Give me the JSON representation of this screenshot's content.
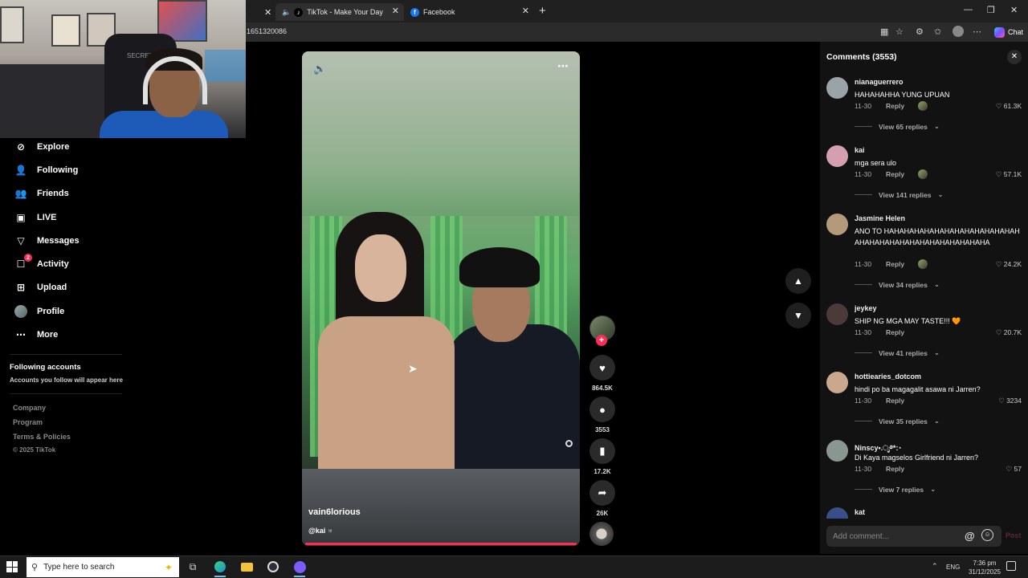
{
  "browser": {
    "tabs": [
      {
        "label": "TikTok - Make Your Day",
        "favicon": "tiktok-icon"
      },
      {
        "label": "Facebook",
        "favicon": "facebook-icon"
      }
    ],
    "url": "1651320086",
    "copilot_label": "Chat"
  },
  "webcam": {
    "chair_text": "SECRET LAB"
  },
  "sidebar": {
    "items": [
      {
        "label": "Explore",
        "icon": "compass-icon"
      },
      {
        "label": "Following",
        "icon": "user-follow-icon"
      },
      {
        "label": "Friends",
        "icon": "friends-icon"
      },
      {
        "label": "LIVE",
        "icon": "live-icon"
      },
      {
        "label": "Messages",
        "icon": "send-icon"
      },
      {
        "label": "Activity",
        "icon": "activity-icon",
        "badge": "2"
      },
      {
        "label": "Upload",
        "icon": "upload-icon"
      },
      {
        "label": "Profile",
        "icon": "avatar"
      },
      {
        "label": "More",
        "icon": "more-icon"
      }
    ],
    "following_title": "Following accounts",
    "following_sub": "Accounts you follow will appear here",
    "footer": [
      "Company",
      "Program",
      "Terms & Policies",
      "© 2025 TikTok"
    ]
  },
  "video": {
    "author": "vain6lorious",
    "mention": "@kai ♅",
    "progress": 1.0
  },
  "actions": {
    "likes": "864.5K",
    "comments": "3553",
    "saves": "17.2K",
    "shares": "26K"
  },
  "comments_panel": {
    "title": "Comments (3553)",
    "items": [
      {
        "user": "nianaguerrero",
        "text": "HAHAHAHHA YUNG UPUAN",
        "date": "11-30",
        "reply": "Reply",
        "likes": "61.3K",
        "view_replies": "View 65 replies",
        "avatar_color": "#9aa4a8"
      },
      {
        "user": "kai",
        "text": "mga sera ulo",
        "date": "11-30",
        "reply": "Reply",
        "likes": "57.1K",
        "view_replies": "View 141 replies",
        "avatar_color": "#d4a0b0"
      },
      {
        "user": "Jasmine Helen",
        "text": "ANO TO HAHAHAHAHAHAHAHAHAHAHAHAHAHAHAHAHAHAHAHAHAHAHAHAHAHAHA",
        "date": "11-30",
        "reply": "Reply",
        "likes": "24.2K",
        "view_replies": "View 34 replies",
        "avatar_color": "#b59a7a"
      },
      {
        "user": "jeykey",
        "text": "SHIP NG MGA MAY TASTE!!! 🧡",
        "date": "11-30",
        "reply": "Reply",
        "likes": "20.7K",
        "view_replies": "View 41 replies",
        "avatar_color": "#4a3a3a"
      },
      {
        "user": "hottiearies_dotcom",
        "text": "hindi po ba magagalit asawa ni Jarren?",
        "date": "11-30",
        "reply": "Reply",
        "likes": "3234",
        "view_replies": "View 35 replies",
        "avatar_color": "#c9a88e"
      },
      {
        "user": "Ninscy•.ೃ࿔*:･",
        "text": "Di Kaya magselos Girlfriend ni Jarren?",
        "date": "11-30",
        "reply": "Reply",
        "likes": "57",
        "view_replies": "View 7 replies",
        "avatar_color": "#8a9690"
      },
      {
        "user": "kat",
        "avatar_color": "#3a4e8a"
      }
    ],
    "add_placeholder": "Add comment...",
    "post_label": "Post"
  },
  "taskbar": {
    "search_placeholder": "Type here to search",
    "lang": "ENG",
    "time": "7:36 pm",
    "date": "31/12/2025"
  }
}
